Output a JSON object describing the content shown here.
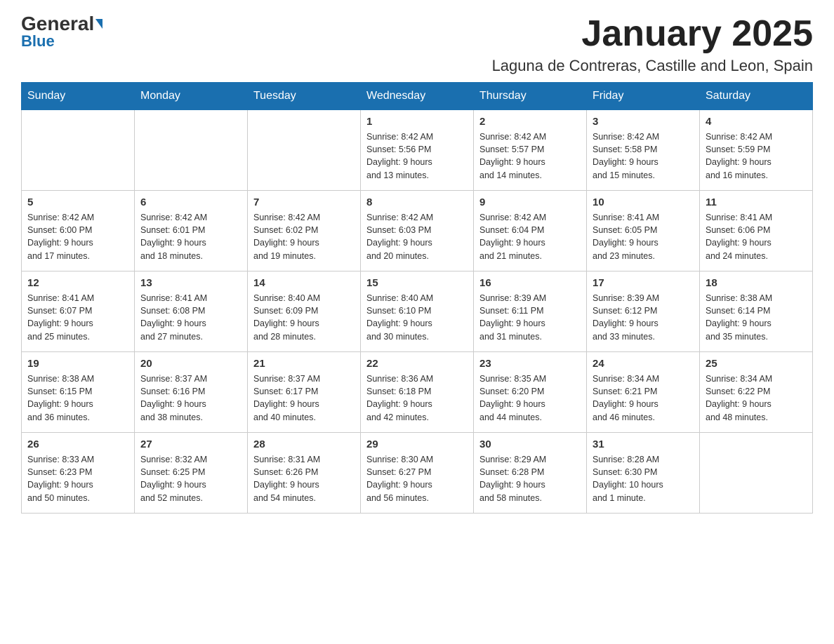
{
  "logo": {
    "text_general": "General",
    "text_blue": "Blue"
  },
  "title": "January 2025",
  "subtitle": "Laguna de Contreras, Castille and Leon, Spain",
  "days_of_week": [
    "Sunday",
    "Monday",
    "Tuesday",
    "Wednesday",
    "Thursday",
    "Friday",
    "Saturday"
  ],
  "weeks": [
    [
      {
        "day": "",
        "info": ""
      },
      {
        "day": "",
        "info": ""
      },
      {
        "day": "",
        "info": ""
      },
      {
        "day": "1",
        "info": "Sunrise: 8:42 AM\nSunset: 5:56 PM\nDaylight: 9 hours\nand 13 minutes."
      },
      {
        "day": "2",
        "info": "Sunrise: 8:42 AM\nSunset: 5:57 PM\nDaylight: 9 hours\nand 14 minutes."
      },
      {
        "day": "3",
        "info": "Sunrise: 8:42 AM\nSunset: 5:58 PM\nDaylight: 9 hours\nand 15 minutes."
      },
      {
        "day": "4",
        "info": "Sunrise: 8:42 AM\nSunset: 5:59 PM\nDaylight: 9 hours\nand 16 minutes."
      }
    ],
    [
      {
        "day": "5",
        "info": "Sunrise: 8:42 AM\nSunset: 6:00 PM\nDaylight: 9 hours\nand 17 minutes."
      },
      {
        "day": "6",
        "info": "Sunrise: 8:42 AM\nSunset: 6:01 PM\nDaylight: 9 hours\nand 18 minutes."
      },
      {
        "day": "7",
        "info": "Sunrise: 8:42 AM\nSunset: 6:02 PM\nDaylight: 9 hours\nand 19 minutes."
      },
      {
        "day": "8",
        "info": "Sunrise: 8:42 AM\nSunset: 6:03 PM\nDaylight: 9 hours\nand 20 minutes."
      },
      {
        "day": "9",
        "info": "Sunrise: 8:42 AM\nSunset: 6:04 PM\nDaylight: 9 hours\nand 21 minutes."
      },
      {
        "day": "10",
        "info": "Sunrise: 8:41 AM\nSunset: 6:05 PM\nDaylight: 9 hours\nand 23 minutes."
      },
      {
        "day": "11",
        "info": "Sunrise: 8:41 AM\nSunset: 6:06 PM\nDaylight: 9 hours\nand 24 minutes."
      }
    ],
    [
      {
        "day": "12",
        "info": "Sunrise: 8:41 AM\nSunset: 6:07 PM\nDaylight: 9 hours\nand 25 minutes."
      },
      {
        "day": "13",
        "info": "Sunrise: 8:41 AM\nSunset: 6:08 PM\nDaylight: 9 hours\nand 27 minutes."
      },
      {
        "day": "14",
        "info": "Sunrise: 8:40 AM\nSunset: 6:09 PM\nDaylight: 9 hours\nand 28 minutes."
      },
      {
        "day": "15",
        "info": "Sunrise: 8:40 AM\nSunset: 6:10 PM\nDaylight: 9 hours\nand 30 minutes."
      },
      {
        "day": "16",
        "info": "Sunrise: 8:39 AM\nSunset: 6:11 PM\nDaylight: 9 hours\nand 31 minutes."
      },
      {
        "day": "17",
        "info": "Sunrise: 8:39 AM\nSunset: 6:12 PM\nDaylight: 9 hours\nand 33 minutes."
      },
      {
        "day": "18",
        "info": "Sunrise: 8:38 AM\nSunset: 6:14 PM\nDaylight: 9 hours\nand 35 minutes."
      }
    ],
    [
      {
        "day": "19",
        "info": "Sunrise: 8:38 AM\nSunset: 6:15 PM\nDaylight: 9 hours\nand 36 minutes."
      },
      {
        "day": "20",
        "info": "Sunrise: 8:37 AM\nSunset: 6:16 PM\nDaylight: 9 hours\nand 38 minutes."
      },
      {
        "day": "21",
        "info": "Sunrise: 8:37 AM\nSunset: 6:17 PM\nDaylight: 9 hours\nand 40 minutes."
      },
      {
        "day": "22",
        "info": "Sunrise: 8:36 AM\nSunset: 6:18 PM\nDaylight: 9 hours\nand 42 minutes."
      },
      {
        "day": "23",
        "info": "Sunrise: 8:35 AM\nSunset: 6:20 PM\nDaylight: 9 hours\nand 44 minutes."
      },
      {
        "day": "24",
        "info": "Sunrise: 8:34 AM\nSunset: 6:21 PM\nDaylight: 9 hours\nand 46 minutes."
      },
      {
        "day": "25",
        "info": "Sunrise: 8:34 AM\nSunset: 6:22 PM\nDaylight: 9 hours\nand 48 minutes."
      }
    ],
    [
      {
        "day": "26",
        "info": "Sunrise: 8:33 AM\nSunset: 6:23 PM\nDaylight: 9 hours\nand 50 minutes."
      },
      {
        "day": "27",
        "info": "Sunrise: 8:32 AM\nSunset: 6:25 PM\nDaylight: 9 hours\nand 52 minutes."
      },
      {
        "day": "28",
        "info": "Sunrise: 8:31 AM\nSunset: 6:26 PM\nDaylight: 9 hours\nand 54 minutes."
      },
      {
        "day": "29",
        "info": "Sunrise: 8:30 AM\nSunset: 6:27 PM\nDaylight: 9 hours\nand 56 minutes."
      },
      {
        "day": "30",
        "info": "Sunrise: 8:29 AM\nSunset: 6:28 PM\nDaylight: 9 hours\nand 58 minutes."
      },
      {
        "day": "31",
        "info": "Sunrise: 8:28 AM\nSunset: 6:30 PM\nDaylight: 10 hours\nand 1 minute."
      },
      {
        "day": "",
        "info": ""
      }
    ]
  ]
}
